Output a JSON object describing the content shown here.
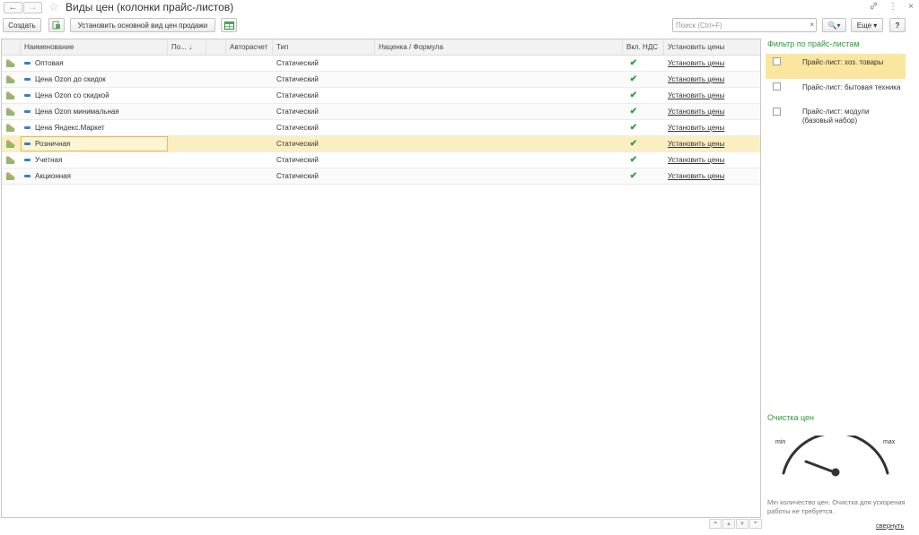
{
  "window": {
    "title": "Виды цен (колонки прайс-листов)",
    "back_icon": "←",
    "forward_icon": "→",
    "favorite_icon": "☆",
    "link_icon": "🔗",
    "menu_icon": "⋮",
    "close_icon": "×"
  },
  "toolbar": {
    "create_label": "Создать",
    "set_view_label": "Установить основной вид цен продажи",
    "search_placeholder": "Поиск (Ctrl+F)",
    "search_clear": "×",
    "search_icon": "🔍▾",
    "more_label": "Еще ▾",
    "help_label": "?"
  },
  "table": {
    "columns": [
      {
        "label": "Наименование"
      },
      {
        "label": "По... ↓"
      },
      {
        "label": ""
      },
      {
        "label": "Авторасчет"
      },
      {
        "label": "Тип"
      },
      {
        "label": "Наценка / Формула"
      },
      {
        "label": "Вкл. НДС"
      },
      {
        "label": "Установить цены"
      }
    ],
    "rows": [
      {
        "name": "Оптовая",
        "type": "Статический",
        "vat": "✔",
        "action": "Установить цены"
      },
      {
        "name": "Цена Ozon до скидок",
        "type": "Статический",
        "vat": "✔",
        "action": "Установить цены"
      },
      {
        "name": "Цена Ozon со скидкой",
        "type": "Статический",
        "vat": "✔",
        "action": "Установить цены"
      },
      {
        "name": "Цена Ozon минимальная",
        "type": "Статический",
        "vat": "✔",
        "action": "Установить цены"
      },
      {
        "name": "Цена Яндекс.Маркет",
        "type": "Статический",
        "vat": "✔",
        "action": "Установить цены"
      },
      {
        "name": "Розничная",
        "type": "Статический",
        "vat": "✔",
        "action": "Установить цены"
      },
      {
        "name": "Учетная",
        "type": "Статический",
        "vat": "✔",
        "action": "Установить цены"
      },
      {
        "name": "Акционная",
        "type": "Статический",
        "vat": "✔",
        "action": "Установить цены"
      }
    ]
  },
  "filter": {
    "title": "Фильтр по прайс-листам",
    "items": [
      {
        "label": "Прайс-лист: хоз. товары"
      },
      {
        "label": "Прайс-лист: бытовая техника"
      },
      {
        "label": "Прайс-лист: модули (базовый набор)"
      }
    ]
  },
  "cleanup": {
    "title": "Очистка цен",
    "gauge_min": "min",
    "gauge_max": "max",
    "note": "Min количество цен. Очистка для ускорения работы не требуется.",
    "collapse_label": "свернуть"
  },
  "scroll": {
    "top": "⏶",
    "up": "▲",
    "down": "▼",
    "bottom": "⏷"
  },
  "colors": {
    "accent_green": "#2b9a3a",
    "selection": "#fbefc2",
    "check_green": "#2e9a3b"
  }
}
